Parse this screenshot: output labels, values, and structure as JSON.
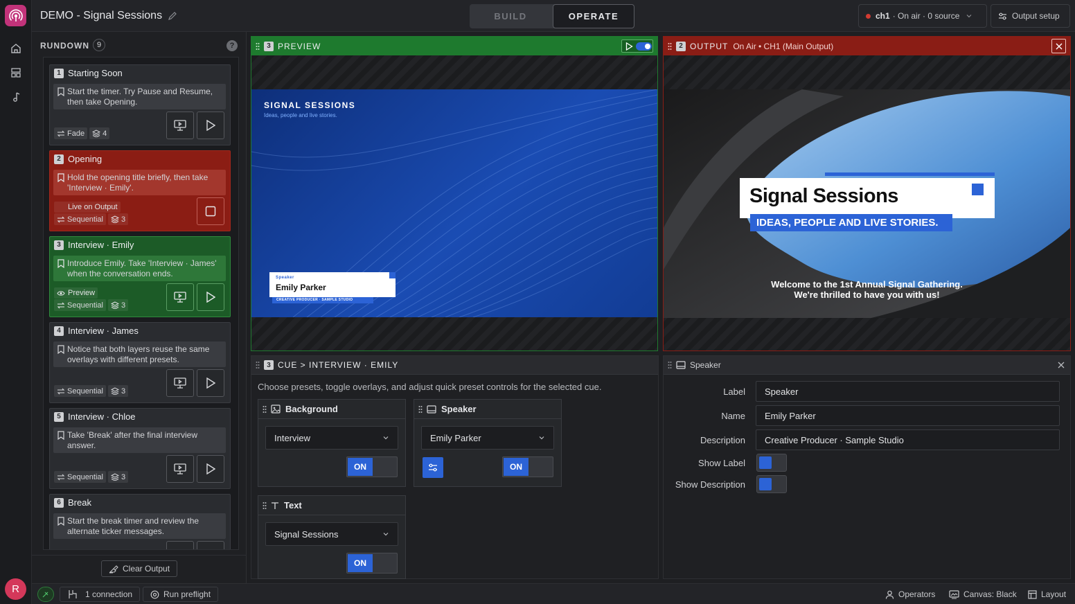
{
  "app": {
    "title": "DEMO - Signal Sessions",
    "avatar_initial": "R"
  },
  "modes": {
    "build": "BUILD",
    "operate": "OPERATE"
  },
  "channel": {
    "name": "ch1",
    "status": "· On air · 0 source",
    "output_setup": "Output setup"
  },
  "rundown": {
    "label": "RUNDOWN",
    "count": "9",
    "help": "?",
    "clear_output": "Clear Output",
    "cues": [
      {
        "num": "1",
        "title": "Starting Soon",
        "note": "Start the timer. Try Pause and Resume, then take Opening.",
        "transition": "Fade",
        "layers": "4",
        "status": ""
      },
      {
        "num": "2",
        "title": "Opening",
        "note": "Hold the opening title briefly, then take 'Interview · Emily'.",
        "transition": "Sequential",
        "layers": "3",
        "status": "Live on Output"
      },
      {
        "num": "3",
        "title": "Interview · Emily",
        "note": "Introduce Emily. Take 'Interview · James' when the conversation ends.",
        "transition": "Sequential",
        "layers": "3",
        "status": "Preview"
      },
      {
        "num": "4",
        "title": "Interview · James",
        "note": "Notice that both layers reuse the same overlays with different presets.",
        "transition": "Sequential",
        "layers": "3",
        "status": ""
      },
      {
        "num": "5",
        "title": "Interview · Chloe",
        "note": "Take 'Break' after the final interview answer.",
        "transition": "Sequential",
        "layers": "3",
        "status": ""
      },
      {
        "num": "6",
        "title": "Break",
        "note": "Start the break timer and review the alternate ticker messages.",
        "transition": "",
        "layers": "",
        "status": ""
      }
    ]
  },
  "preview": {
    "num": "3",
    "label": "PREVIEW",
    "brand": "SIGNAL SESSIONS",
    "tagline": "Ideas, people and live stories.",
    "lt_label": "Speaker",
    "lt_name": "Emily Parker",
    "lt_desc": "CREATIVE PRODUCER · SAMPLE STUDIO"
  },
  "output": {
    "num": "2",
    "label": "OUTPUT",
    "status": "On Air • CH1 (Main Output)",
    "title": "Signal Sessions",
    "subtitle": "IDEAS, PEOPLE AND LIVE STORIES.",
    "welcome1": "Welcome to the 1st Annual Signal Gathering.",
    "welcome2": "We're thrilled to have you with us!"
  },
  "cue": {
    "num": "3",
    "path": "CUE > INTERVIEW · EMILY",
    "hint": "Choose presets, toggle overlays, and adjust quick preset controls for the selected cue.",
    "layers": [
      {
        "name": "Background",
        "preset": "Interview",
        "toggle": "ON"
      },
      {
        "name": "Speaker",
        "preset": "Emily Parker",
        "toggle": "ON"
      },
      {
        "name": "Text",
        "preset": "Signal Sessions",
        "toggle": "ON"
      }
    ]
  },
  "speaker_panel": {
    "title": "Speaker",
    "fields": [
      {
        "label": "Label",
        "value": "Speaker"
      },
      {
        "label": "Name",
        "value": "Emily Parker"
      },
      {
        "label": "Description",
        "value": "Creative Producer · Sample Studio"
      }
    ],
    "show_label": "Show Label",
    "show_description": "Show Description"
  },
  "footer": {
    "connections": "1 connection",
    "preflight": "Run preflight",
    "operators": "Operators",
    "canvas": "Canvas: Black",
    "layout": "Layout"
  },
  "colors": {
    "accent": "#2c63d6",
    "live": "#8b1d14",
    "preview": "#1c5b27",
    "brand": "#c2337a"
  }
}
